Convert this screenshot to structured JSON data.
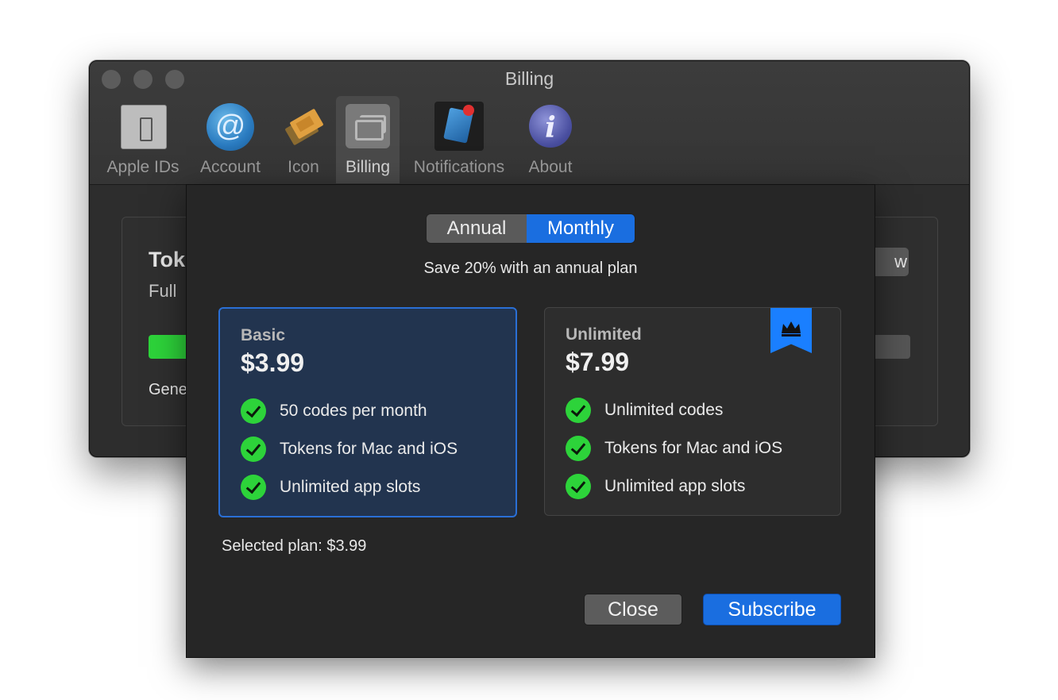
{
  "window": {
    "title": "Billing",
    "toolbar": [
      {
        "label": "Apple IDs",
        "icon": "phone-icon"
      },
      {
        "label": "Account",
        "icon": "at-sign-icon"
      },
      {
        "label": "Icon",
        "icon": "tickets-icon"
      },
      {
        "label": "Billing",
        "icon": "cards-icon",
        "active": true
      },
      {
        "label": "Notifications",
        "icon": "notifications-icon"
      },
      {
        "label": "About",
        "icon": "info-icon"
      }
    ],
    "account_icon_glyph": "@",
    "about_icon_glyph": "i",
    "background_peek": {
      "title": "Tok",
      "subtitle": "Full",
      "footer": "Gene",
      "button_fragment": "w",
      "progress_color": "#2dd33a"
    }
  },
  "sheet": {
    "segment": {
      "options": [
        "Annual",
        "Monthly"
      ],
      "selected": "Monthly"
    },
    "save_note": "Save 20% with an annual plan",
    "plans": [
      {
        "name": "Basic",
        "price": "$3.99",
        "selected": true,
        "features": [
          "50 codes per month",
          "Tokens for Mac and iOS",
          "Unlimited app slots"
        ]
      },
      {
        "name": "Unlimited",
        "price": "$7.99",
        "selected": false,
        "badge_icon": "crown-icon",
        "features": [
          "Unlimited codes",
          "Tokens for Mac and iOS",
          "Unlimited app slots"
        ]
      }
    ],
    "selected_plan": "Selected plan: $3.99",
    "buttons": {
      "close": "Close",
      "subscribe": "Subscribe"
    }
  },
  "colors": {
    "accent": "#1a6ee0",
    "check": "#2dd33a",
    "ribbon": "#1a7fff",
    "selected_plan_bg": "#22344f"
  }
}
